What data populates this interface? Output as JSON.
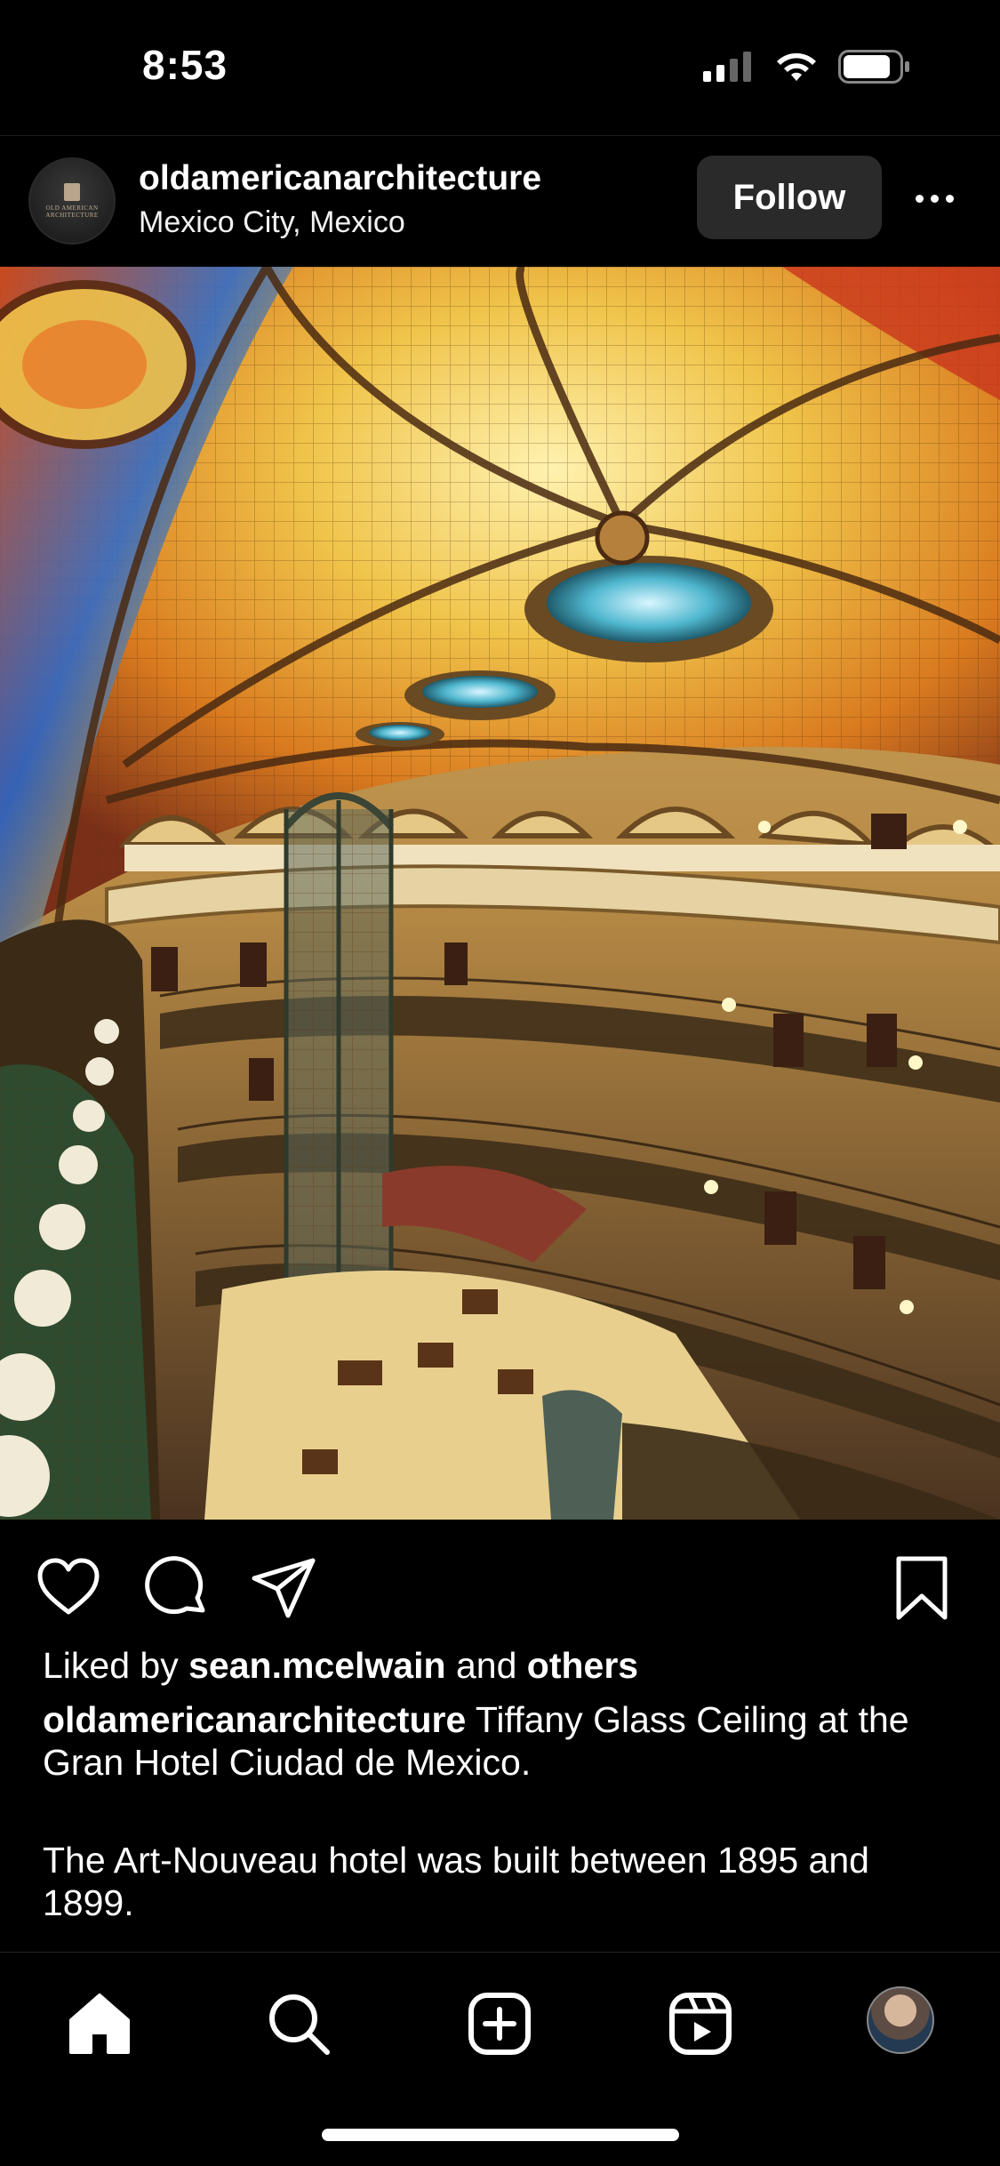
{
  "status_bar": {
    "time": "8:53"
  },
  "header": {
    "username": "oldamericanarchitecture",
    "location": "Mexico City, Mexico",
    "follow_label": "Follow",
    "avatar_text": "OLD AMERICAN ARCHITECTURE"
  },
  "post": {
    "likes_prefix": "Liked by",
    "liked_by_user": "sean.mcelwain",
    "likes_and": "and",
    "likes_others": "others",
    "caption_username": "oldamericanarchitecture",
    "caption_text": "Tiffany Glass Ceiling at the Gran Hotel Ciudad de Mexico.",
    "caption_more": "The Art-Nouveau hotel was built between 1895 and 1899."
  },
  "icons": {
    "actions": [
      "heart-icon",
      "comment-icon",
      "share-icon",
      "bookmark-icon"
    ],
    "tabs": [
      "home-icon",
      "search-icon",
      "create-icon",
      "reels-icon",
      "profile-avatar"
    ]
  },
  "colors": {
    "background": "#000000",
    "follow_button": "#2a2a2a",
    "text": "#ffffff"
  }
}
